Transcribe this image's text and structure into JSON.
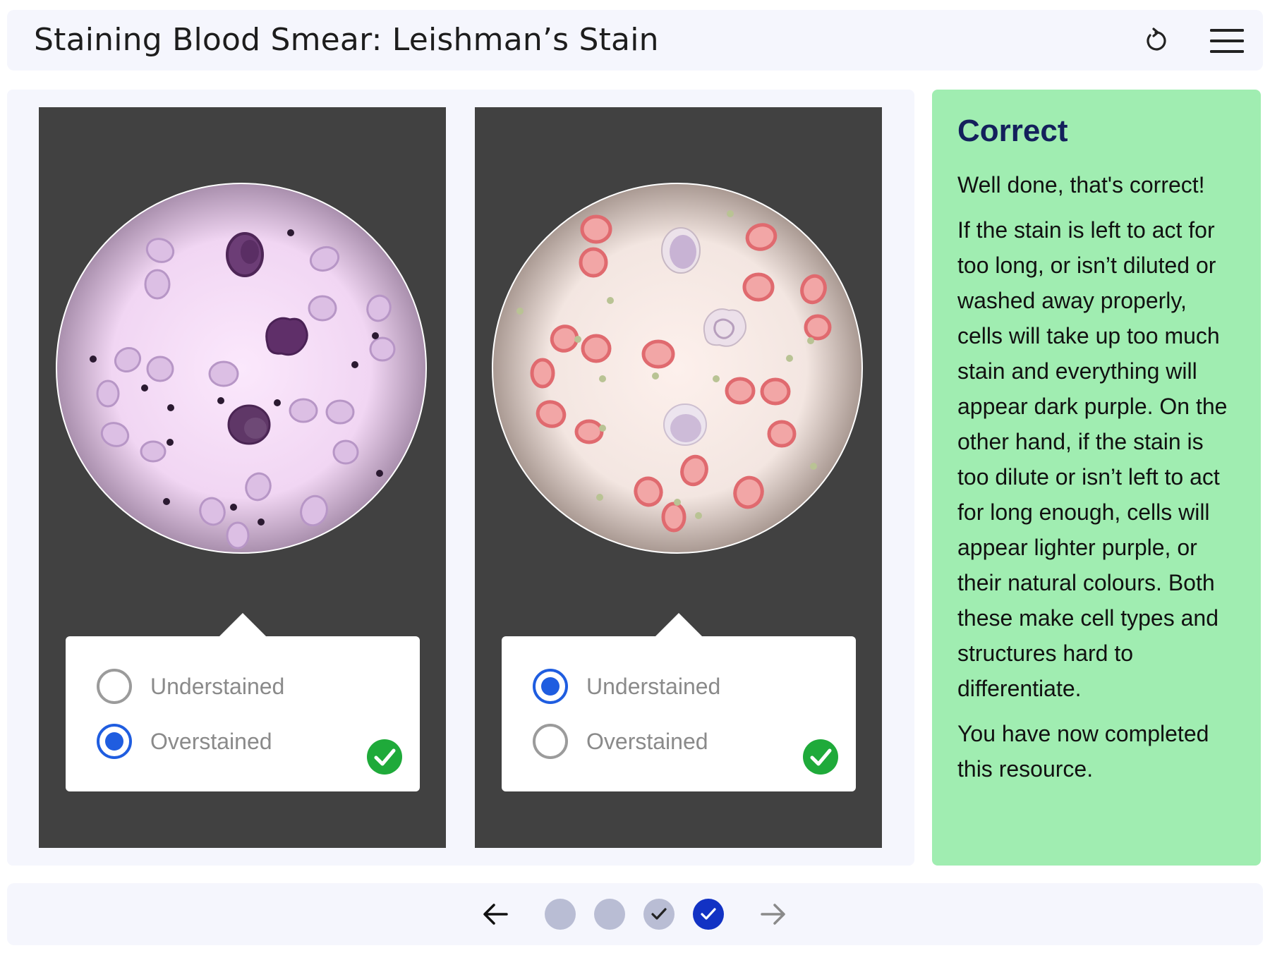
{
  "header": {
    "title": "Staining Blood Smear: Leishman’s Stain",
    "reset_icon": "reset-icon",
    "menu_icon": "hamburger-menu-icon"
  },
  "questions": [
    {
      "image": "overstained-blood-smear",
      "options": [
        {
          "label": "Understained",
          "selected": false
        },
        {
          "label": "Overstained",
          "selected": true
        }
      ],
      "result_icon": "correct-check-icon"
    },
    {
      "image": "understained-blood-smear",
      "options": [
        {
          "label": "Understained",
          "selected": true
        },
        {
          "label": "Overstained",
          "selected": false
        }
      ],
      "result_icon": "correct-check-icon"
    }
  ],
  "feedback": {
    "title": "Correct",
    "paragraphs": [
      "Well done, that's correct!",
      "If the stain is left to act for too long, or isn’t diluted or washed away properly, cells will take up too much stain and everything will appear dark purple. On the other hand, if the stain is too dilute or isn’t left to act for long enough, cells will appear lighter purple, or their natural colours. Both these make cell types and structures hard to differentiate.",
      "You have now completed this resource."
    ],
    "bg_color": "#a0edb1"
  },
  "footer": {
    "prev_icon": "arrow-left-icon",
    "next_icon": "arrow-right-icon",
    "pages": [
      {
        "state": "unvisited"
      },
      {
        "state": "unvisited"
      },
      {
        "state": "completed"
      },
      {
        "state": "current-completed"
      }
    ]
  },
  "colors": {
    "accent": "#1f5de0",
    "success": "#1faa3a",
    "current_page": "#1232c4",
    "panel_bg": "#414141"
  }
}
